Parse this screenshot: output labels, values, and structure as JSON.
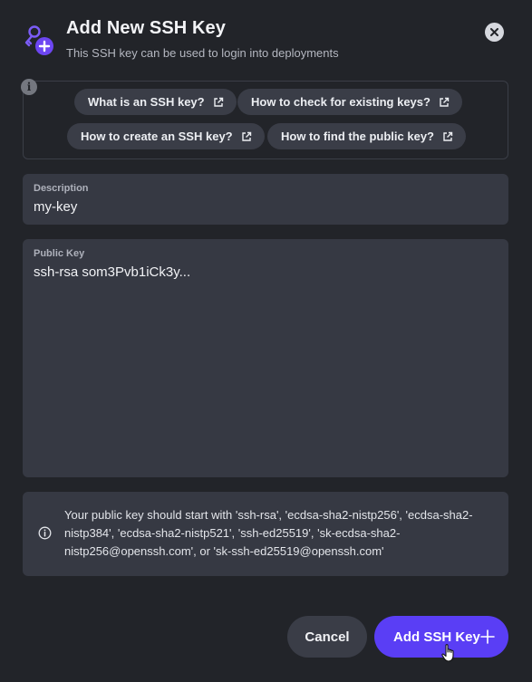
{
  "dialog": {
    "title": "Add New SSH Key",
    "subtitle": "This SSH key can be used to login into deployments"
  },
  "help_links": [
    {
      "label": "What is an SSH key?"
    },
    {
      "label": "How to check for existing keys?"
    },
    {
      "label": "How to create an SSH key?"
    },
    {
      "label": "How to find the public key?"
    }
  ],
  "description": {
    "label": "Description",
    "value": "my-key"
  },
  "public_key": {
    "label": "Public Key",
    "value": "ssh-rsa som3Pvb1iCk3y..."
  },
  "notice": {
    "text": "Your public key should start with 'ssh-rsa', 'ecdsa-sha2-nistp256', 'ecdsa-sha2-nistp384', 'ecdsa-sha2-nistp521', 'ssh-ed25519', 'sk-ecdsa-sha2-nistp256@openssh.com', or 'sk-ssh-ed25519@openssh.com'"
  },
  "actions": {
    "cancel_label": "Cancel",
    "add_label": "Add SSH Key"
  },
  "colors": {
    "background": "#222429",
    "panel": "#363943",
    "chip": "#3a3d47",
    "accent": "#5a3ef5",
    "key_icon": "#7b5cf6"
  },
  "icons": {
    "header": "key-plus-icon",
    "close": "close-icon",
    "info": "info-icon",
    "external_link": "external-link-icon",
    "add": "plus-icon"
  }
}
